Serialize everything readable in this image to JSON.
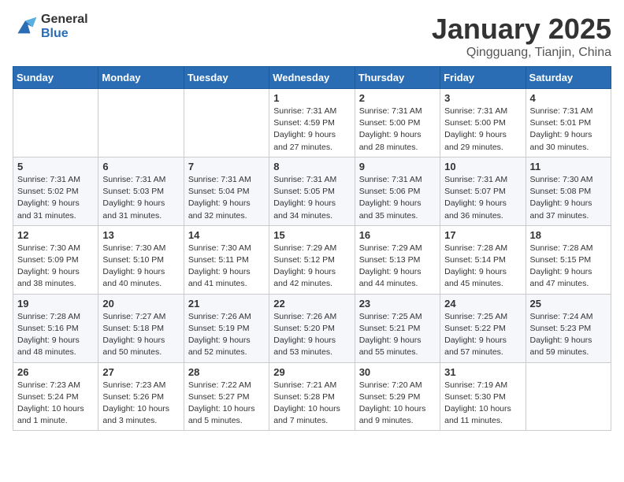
{
  "logo": {
    "line1": "General",
    "line2": "Blue"
  },
  "title": "January 2025",
  "subtitle": "Qingguang, Tianjin, China",
  "header": {
    "days": [
      "Sunday",
      "Monday",
      "Tuesday",
      "Wednesday",
      "Thursday",
      "Friday",
      "Saturday"
    ]
  },
  "weeks": [
    [
      {
        "day": "",
        "info": ""
      },
      {
        "day": "",
        "info": ""
      },
      {
        "day": "",
        "info": ""
      },
      {
        "day": "1",
        "info": "Sunrise: 7:31 AM\nSunset: 4:59 PM\nDaylight: 9 hours and 27 minutes."
      },
      {
        "day": "2",
        "info": "Sunrise: 7:31 AM\nSunset: 5:00 PM\nDaylight: 9 hours and 28 minutes."
      },
      {
        "day": "3",
        "info": "Sunrise: 7:31 AM\nSunset: 5:00 PM\nDaylight: 9 hours and 29 minutes."
      },
      {
        "day": "4",
        "info": "Sunrise: 7:31 AM\nSunset: 5:01 PM\nDaylight: 9 hours and 30 minutes."
      }
    ],
    [
      {
        "day": "5",
        "info": "Sunrise: 7:31 AM\nSunset: 5:02 PM\nDaylight: 9 hours and 31 minutes."
      },
      {
        "day": "6",
        "info": "Sunrise: 7:31 AM\nSunset: 5:03 PM\nDaylight: 9 hours and 31 minutes."
      },
      {
        "day": "7",
        "info": "Sunrise: 7:31 AM\nSunset: 5:04 PM\nDaylight: 9 hours and 32 minutes."
      },
      {
        "day": "8",
        "info": "Sunrise: 7:31 AM\nSunset: 5:05 PM\nDaylight: 9 hours and 34 minutes."
      },
      {
        "day": "9",
        "info": "Sunrise: 7:31 AM\nSunset: 5:06 PM\nDaylight: 9 hours and 35 minutes."
      },
      {
        "day": "10",
        "info": "Sunrise: 7:31 AM\nSunset: 5:07 PM\nDaylight: 9 hours and 36 minutes."
      },
      {
        "day": "11",
        "info": "Sunrise: 7:30 AM\nSunset: 5:08 PM\nDaylight: 9 hours and 37 minutes."
      }
    ],
    [
      {
        "day": "12",
        "info": "Sunrise: 7:30 AM\nSunset: 5:09 PM\nDaylight: 9 hours and 38 minutes."
      },
      {
        "day": "13",
        "info": "Sunrise: 7:30 AM\nSunset: 5:10 PM\nDaylight: 9 hours and 40 minutes."
      },
      {
        "day": "14",
        "info": "Sunrise: 7:30 AM\nSunset: 5:11 PM\nDaylight: 9 hours and 41 minutes."
      },
      {
        "day": "15",
        "info": "Sunrise: 7:29 AM\nSunset: 5:12 PM\nDaylight: 9 hours and 42 minutes."
      },
      {
        "day": "16",
        "info": "Sunrise: 7:29 AM\nSunset: 5:13 PM\nDaylight: 9 hours and 44 minutes."
      },
      {
        "day": "17",
        "info": "Sunrise: 7:28 AM\nSunset: 5:14 PM\nDaylight: 9 hours and 45 minutes."
      },
      {
        "day": "18",
        "info": "Sunrise: 7:28 AM\nSunset: 5:15 PM\nDaylight: 9 hours and 47 minutes."
      }
    ],
    [
      {
        "day": "19",
        "info": "Sunrise: 7:28 AM\nSunset: 5:16 PM\nDaylight: 9 hours and 48 minutes."
      },
      {
        "day": "20",
        "info": "Sunrise: 7:27 AM\nSunset: 5:18 PM\nDaylight: 9 hours and 50 minutes."
      },
      {
        "day": "21",
        "info": "Sunrise: 7:26 AM\nSunset: 5:19 PM\nDaylight: 9 hours and 52 minutes."
      },
      {
        "day": "22",
        "info": "Sunrise: 7:26 AM\nSunset: 5:20 PM\nDaylight: 9 hours and 53 minutes."
      },
      {
        "day": "23",
        "info": "Sunrise: 7:25 AM\nSunset: 5:21 PM\nDaylight: 9 hours and 55 minutes."
      },
      {
        "day": "24",
        "info": "Sunrise: 7:25 AM\nSunset: 5:22 PM\nDaylight: 9 hours and 57 minutes."
      },
      {
        "day": "25",
        "info": "Sunrise: 7:24 AM\nSunset: 5:23 PM\nDaylight: 9 hours and 59 minutes."
      }
    ],
    [
      {
        "day": "26",
        "info": "Sunrise: 7:23 AM\nSunset: 5:24 PM\nDaylight: 10 hours and 1 minute."
      },
      {
        "day": "27",
        "info": "Sunrise: 7:23 AM\nSunset: 5:26 PM\nDaylight: 10 hours and 3 minutes."
      },
      {
        "day": "28",
        "info": "Sunrise: 7:22 AM\nSunset: 5:27 PM\nDaylight: 10 hours and 5 minutes."
      },
      {
        "day": "29",
        "info": "Sunrise: 7:21 AM\nSunset: 5:28 PM\nDaylight: 10 hours and 7 minutes."
      },
      {
        "day": "30",
        "info": "Sunrise: 7:20 AM\nSunset: 5:29 PM\nDaylight: 10 hours and 9 minutes."
      },
      {
        "day": "31",
        "info": "Sunrise: 7:19 AM\nSunset: 5:30 PM\nDaylight: 10 hours and 11 minutes."
      },
      {
        "day": "",
        "info": ""
      }
    ]
  ]
}
